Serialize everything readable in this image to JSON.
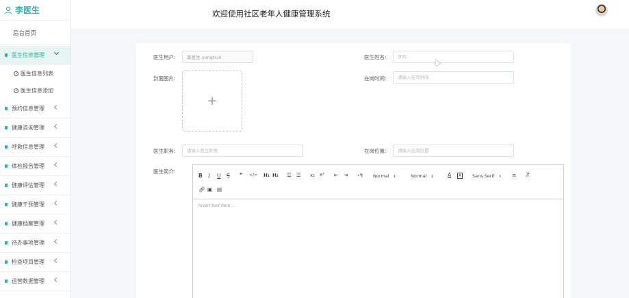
{
  "brand": {
    "name": "李医生"
  },
  "header": {
    "title": "欢迎使用社区老年人健康管理系统"
  },
  "sidebar": {
    "home": "后台首页",
    "active": {
      "label": "医生信息管理",
      "sub": [
        "医生信息列表",
        "医生信息添加"
      ]
    },
    "items": [
      "预约信息管理",
      "健康咨询管理",
      "呼救信息管理",
      "体检报告管理",
      "健康评估管理",
      "健康干预管理",
      "健康档案管理",
      "待办事项管理",
      "检查项目管理",
      "运营数据管理"
    ]
  },
  "form": {
    "doctor_user_label": "医生用户:",
    "doctor_user_value": "李医生-yonghu4",
    "doctor_name_label": "医生姓名:",
    "doctor_name_value": "李四",
    "cover_label": "封面图片:",
    "upload_icon": "+",
    "online_time_label": "在岗时间:",
    "online_time_placeholder": "请输入在岗时间",
    "position_label": "医生职务:",
    "position_placeholder": "请输入医生职务",
    "location_label": "在岗位置:",
    "location_placeholder": "请输入在岗位置",
    "intro_label": "医生简介:"
  },
  "editor": {
    "header_picker": "Normal",
    "size_picker": "Normal",
    "font_picker": "Sans Serif",
    "placeholder": "Insert text here ..."
  },
  "colors": {
    "accent": "#2ab3a6"
  }
}
